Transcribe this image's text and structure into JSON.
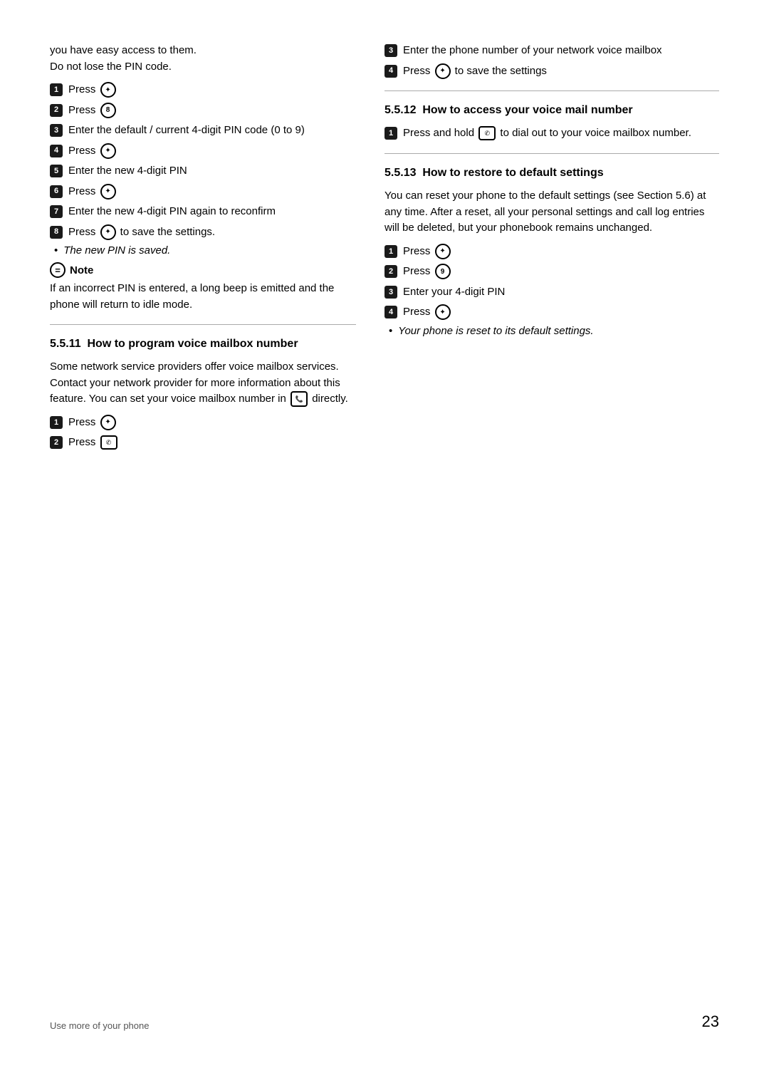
{
  "page": {
    "footer": {
      "left": "Use more of your phone",
      "page_number": "23"
    }
  },
  "left_col": {
    "intro": {
      "line1": "you have easy access to them.",
      "line2": "Do not lose the PIN code."
    },
    "steps_pin": [
      {
        "num": "1",
        "text": "Press",
        "icon": "nav"
      },
      {
        "num": "2",
        "text": "Press",
        "icon": "8"
      },
      {
        "num": "3",
        "text": "Enter the default / current 4-digit PIN code (0 to 9)"
      },
      {
        "num": "4",
        "text": "Press",
        "icon": "nav"
      },
      {
        "num": "5",
        "text": "Enter the new 4-digit PIN"
      },
      {
        "num": "6",
        "text": "Press",
        "icon": "nav"
      },
      {
        "num": "7",
        "text": "Enter the new 4-digit PIN again to reconfirm"
      },
      {
        "num": "8",
        "text": "Press",
        "icon": "nav",
        "suffix": " to save the settings."
      }
    ],
    "bullet_pin": "The new PIN is saved.",
    "note_header": "Note",
    "note_text": "If an incorrect PIN is entered, a long beep is emitted and the phone will return to idle mode.",
    "section_511": {
      "number": "5.5.11",
      "title": "How to program voice mailbox number",
      "body1": "Some network service providers offer voice mailbox services. Contact your network provider for more information about this feature. You can set your voice mailbox number in",
      "body2": "directly.",
      "steps": [
        {
          "num": "1",
          "text": "Press",
          "icon": "nav"
        },
        {
          "num": "2",
          "text": "Press",
          "icon": "voicemail"
        }
      ]
    }
  },
  "right_col": {
    "steps_511_cont": [
      {
        "num": "3",
        "text": "Enter the phone number of your network voice mailbox"
      },
      {
        "num": "4",
        "text": "Press",
        "icon": "nav",
        "suffix": " to save the settings"
      }
    ],
    "section_512": {
      "number": "5.5.12",
      "title": "How to access your voice mail number",
      "steps": [
        {
          "num": "1",
          "text": "Press and hold",
          "icon": "voicemail-hold",
          "suffix": " to dial out to your voice mailbox number."
        }
      ]
    },
    "section_513": {
      "number": "5.5.13",
      "title": "How to restore to default settings",
      "body": "You can reset your phone to the default settings (see Section 5.6) at any time. After a reset, all your personal settings and call log entries will be deleted, but your phonebook remains unchanged.",
      "steps": [
        {
          "num": "1",
          "text": "Press",
          "icon": "nav"
        },
        {
          "num": "2",
          "text": "Press",
          "icon": "9"
        },
        {
          "num": "3",
          "text": "Enter your 4-digit PIN"
        },
        {
          "num": "4",
          "text": "Press",
          "icon": "nav"
        }
      ],
      "bullet": "Your phone is reset to its default settings."
    }
  }
}
